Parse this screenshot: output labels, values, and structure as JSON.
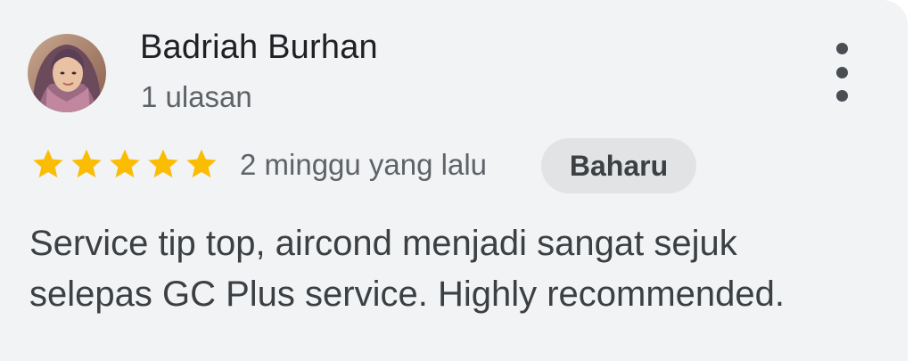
{
  "review": {
    "author_name": "Badriah Burhan",
    "review_count": "1 ulasan",
    "rating": 5,
    "rating_max": 5,
    "time_ago": "2 minggu yang lalu",
    "badge": "Baharu",
    "text_line_1": "Service tip top, aircond menjadi sangat sejuk",
    "text_line_2": "selepas GC Plus service. Highly recommended."
  },
  "colors": {
    "card_background": "#f1f3f4",
    "star": "#fbbc04",
    "badge_background": "#e1e3e5"
  },
  "icons": {
    "menu": "more-vertical-icon",
    "star": "star-icon"
  }
}
